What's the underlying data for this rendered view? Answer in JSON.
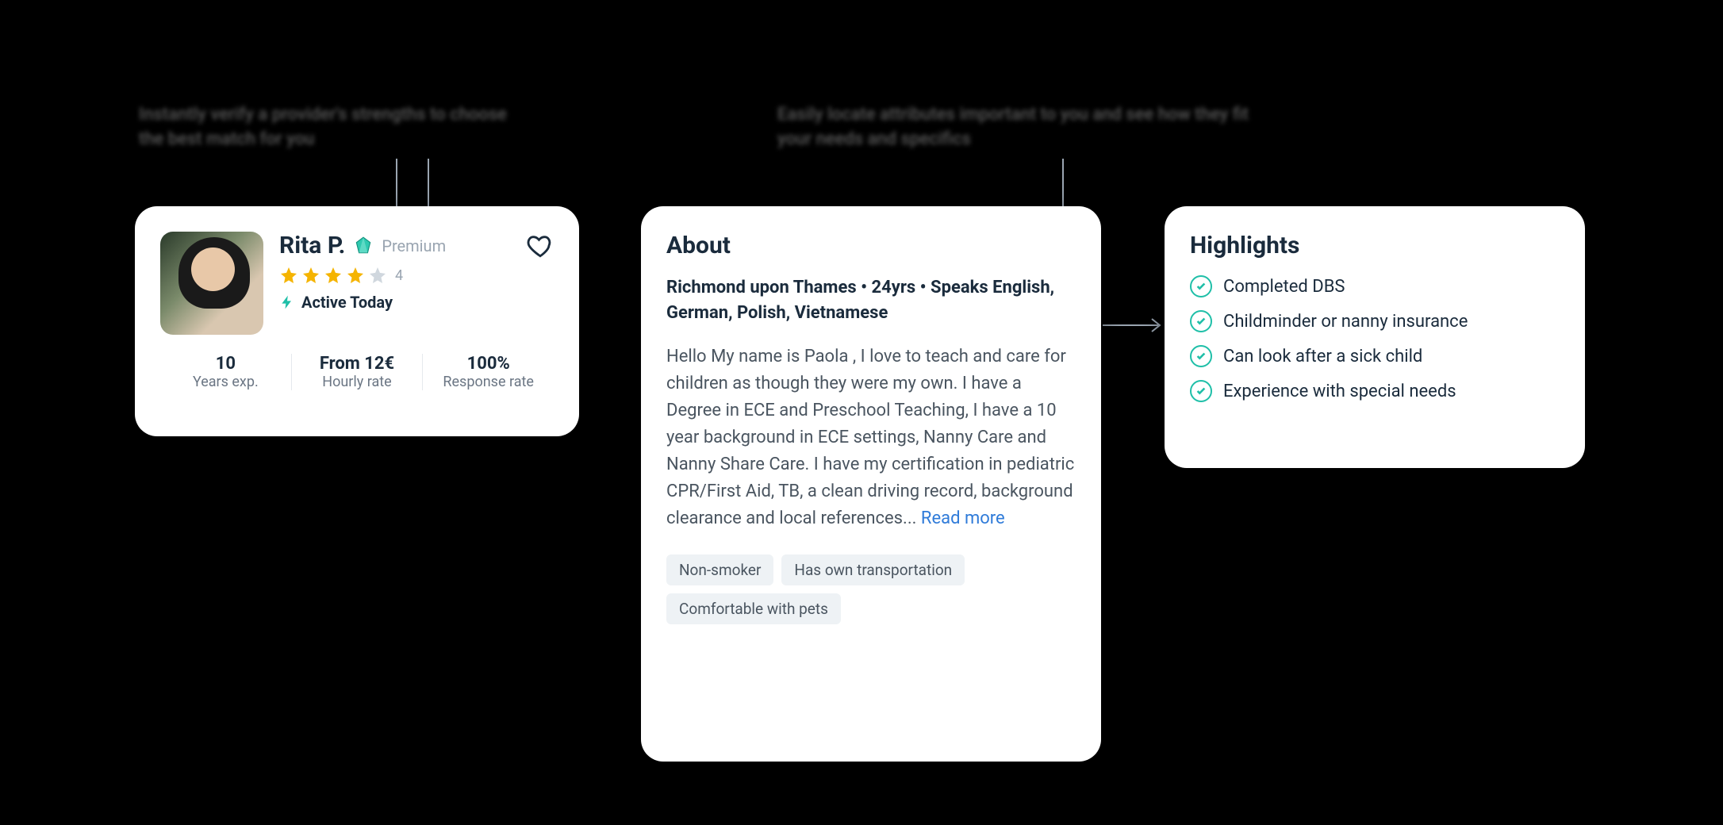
{
  "annotations": {
    "left_top": "Instantly verify a provider's strengths to choose the best match for you",
    "right_top": "Easily locate attributes important to you and see how they fit your needs and specifics"
  },
  "profile": {
    "name": "Rita P.",
    "premium_label": "Premium",
    "rating_count": "4",
    "active_text": "Active Today",
    "stats": {
      "exp_val": "10",
      "exp_lbl": "Years exp.",
      "rate_val": "From 12€",
      "rate_lbl": "Hourly rate",
      "resp_val": "100%",
      "resp_lbl": "Response rate"
    }
  },
  "about": {
    "title": "About",
    "meta": "Richmond upon Thames  •  24yrs  •  Speaks English, German, Polish, Vietnamese",
    "body": "Hello My name is Paola , I love to teach and care for children as though they were my own. I have a Degree in ECE and Preschool Teaching, I have a 10 year background in ECE settings, Nanny Care and Nanny Share Care. I have my certification in pediatric CPR/First Aid, TB, a clean driving record, background clearance and local references... ",
    "read_more": "Read more",
    "tags": [
      "Non-smoker",
      "Has own transportation",
      "Comfortable with pets"
    ]
  },
  "highlights": {
    "title": "Highlights",
    "items": [
      "Completed DBS",
      "Childminder or nanny insurance",
      "Can look after a sick child",
      "Experience with special needs"
    ]
  }
}
